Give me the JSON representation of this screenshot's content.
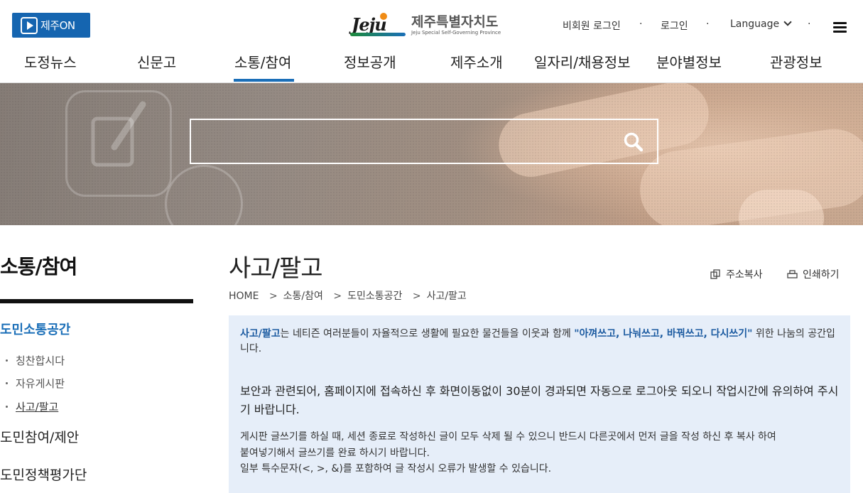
{
  "header": {
    "jejuon_label": "제주ON",
    "logo_ko": "제주특별자치도",
    "logo_en": "Jeju Special Self-Governing Province",
    "logo_word": "Jeju",
    "util": {
      "member_login": "비회원 로그인",
      "login": "로그인",
      "language": "Language",
      "dot": "·"
    }
  },
  "gnb": {
    "items": [
      "도정뉴스",
      "신문고",
      "소통/참여",
      "정보공개",
      "제주소개",
      "일자리/채용정보",
      "분야별정보",
      "관광정보"
    ],
    "active": "소통/참여"
  },
  "search": {
    "placeholder": ""
  },
  "sidebar": {
    "title": "소통/참여",
    "group": "도민소통공간",
    "subitems": [
      "칭찬합시다",
      "자유게시판",
      "사고/팔고"
    ],
    "current": "사고/팔고",
    "others": [
      "도민참여/제안",
      "도민정책평가단"
    ]
  },
  "content": {
    "title": "사고/팔고",
    "tools": {
      "copy": "주소복사",
      "print": "인쇄하기"
    },
    "breadcrumb": [
      "HOME",
      "소통/참여",
      "도민소통공간",
      "사고/팔고"
    ],
    "breadcrumb_sep": ">",
    "notice": {
      "p1_lead": "사고/팔고",
      "p1_mid": "는 네티즌 여러분들이 자율적으로 생활에 필요한 물건들을 이웃과 함께 ",
      "p1_quote": "\"아껴쓰고, 나눠쓰고, 바꿔쓰고, 다시쓰기\"",
      "p1_end": " 위한 나눔의 공간입니다.",
      "p2": "보안과 관련되어, 홈페이지에 접속하신 후 화면이동없이 30분이 경과되면 자동으로 로그아웃 되오니 작업시간에 유의하여 주시기 바랍니다.",
      "p3_line1": "게시판 글쓰기를 하실 때, 세션 종료로 작성하신 글이 모두 삭제 될 수 있으니 반드시 다른곳에서 먼저 글을 작성 하신 후 복사 하여",
      "p3_line2": "붙여넣기해서 글쓰기를 완료 하시기 바랍니다.",
      "p3_line3": "일부 특수문자(<, >, &)를 포함하여 글 작성시 오류가 발생할 수 있습니다."
    }
  },
  "colors": {
    "brand_blue": "#1565b0",
    "active_bar": "#1b6fb8",
    "notice_bg": "#e6eef9"
  },
  "icons": [
    "play-icon",
    "chevron-down-icon",
    "hamburger-menu-icon",
    "search-icon",
    "copy-icon",
    "print-icon"
  ]
}
